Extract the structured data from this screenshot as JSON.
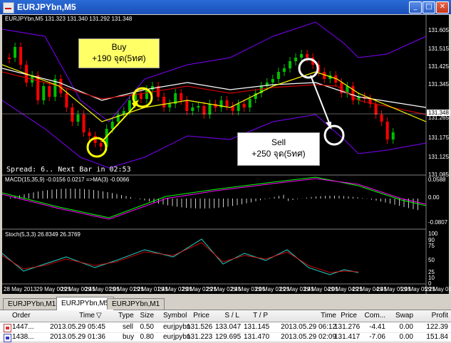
{
  "window": {
    "title": "EURJPYbn,M5",
    "min": "_",
    "max": "□",
    "close": "✕"
  },
  "chart": {
    "main_label": "EURJPYbn,M5  131.323 131.340 131.292 131.348",
    "spread_text": "Spread: 6.. Next Bar in 02:53",
    "price_axis": [
      "131.605",
      "131.515",
      "131.425",
      "131.345",
      "131.348",
      "131.265",
      "131.175",
      "131.125",
      "131.085"
    ],
    "current_price": "131.348",
    "macd_label": "MACD(15,35,9) -0.0156 0.0217 =>MA(3) -0.0066",
    "macd_axis": [
      "0.0588",
      "0.00",
      "-0.0807"
    ],
    "stoch_label": "Stoch(5,3,3) 26.8349 26.3769",
    "stoch_axis": [
      "100",
      "90",
      "75",
      "50",
      "25",
      "10",
      "0"
    ],
    "time_axis": [
      "28 May 2013",
      "29 May 00:25",
      "29 May 00:45",
      "29 May 01:05",
      "29 May 01:25",
      "29 May 01:45",
      "29 May 02:05",
      "29 May 02:25",
      "29 May 02:45",
      "29 May 03:05",
      "29 May 03:25",
      "29 May 03:45",
      "29 May 04:05",
      "29 May 04:25",
      "29 May 04:45",
      "29 May 05:05",
      "29 May 05:25",
      "29 May 05:45"
    ],
    "callout_buy": {
      "line1": "Buy",
      "line2": "+190 จุด(5ทศ)"
    },
    "callout_sell": {
      "line1": "Sell",
      "line2": "+250 จุด(5ทศ)"
    },
    "colors": {
      "bull": "#00c000",
      "bear": "#ff0000",
      "bb": "#8000ff",
      "ma_red": "#cc0000",
      "ma_yellow": "#ffff00",
      "ma_white": "#ffffff",
      "macd_line": "#ff00ff",
      "macd_signal": "#00ff00",
      "stoch_main": "#20b2aa",
      "stoch_signal": "#ff0000"
    }
  },
  "tabs": [
    "EURJPYbn,M15",
    "EURJPYbn,M5",
    "EURJPYbn,M1"
  ],
  "active_tab": "EURJPYbn,M5",
  "table": {
    "headers": [
      "Order",
      "Time",
      "Type",
      "Size",
      "Symbol",
      "Price",
      "S / L",
      "T / P",
      "Time",
      "Price",
      "Com...",
      "Swap",
      "Profit"
    ],
    "rows": [
      [
        "1447...",
        "2013.05.29 05:45",
        "sell",
        "0.50",
        "eurjpybn",
        "131.526",
        "133.047",
        "131.145",
        "2013.05.29 06:12",
        "131.276",
        "-4.41",
        "0.00",
        "122.39"
      ],
      [
        "1438...",
        "2013.05.29 01:36",
        "buy",
        "0.80",
        "eurjpybn",
        "131.223",
        "129.695",
        "131.470",
        "2013.05.29 02:09",
        "131.417",
        "-7.06",
        "0.00",
        "151.84"
      ]
    ]
  }
}
